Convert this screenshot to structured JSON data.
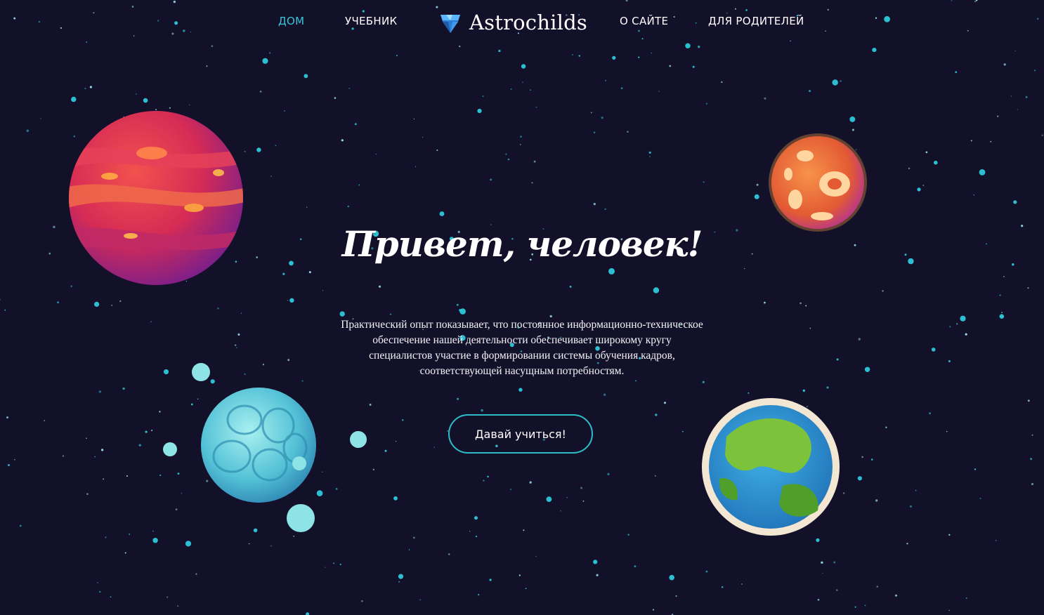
{
  "nav": {
    "home": "ДОМ",
    "textbook": "УЧЕБНИК",
    "about": "О САЙТЕ",
    "parents": "ДЛЯ РОДИТЕЛЕЙ",
    "logo_text": "Astrochilds",
    "logo_icon": "diamond-icon"
  },
  "hero": {
    "title": "Привет, человек!",
    "description": "Практический опыт показывает, что постоянное информационно-техническое обеспечение нашей деятельности обеспечивает широкому кругу специалистов участие в формировании системы обучения кадров, соответствующей насущным потребностям.",
    "cta_label": "Давай учиться!"
  },
  "colors": {
    "background": "#13112a",
    "accent": "#37c6d6",
    "button_border": "#2dbdc7",
    "text": "#ffffff"
  }
}
